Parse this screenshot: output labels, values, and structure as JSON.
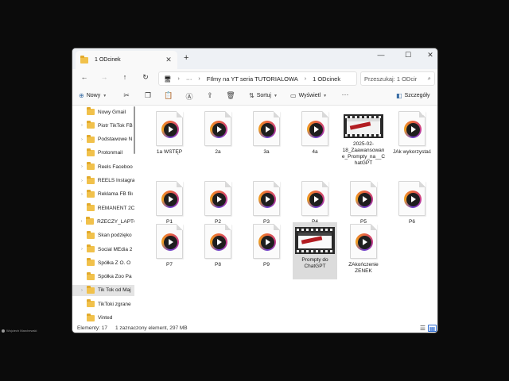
{
  "window": {
    "tab_title": "1 ODcinek",
    "new_tab": "+",
    "controls": {
      "minimize": "—",
      "maximize": "☐",
      "close": "✕"
    }
  },
  "navigation": {
    "back": "←",
    "forward": "→",
    "up": "↑",
    "refresh": "↻",
    "more": "···",
    "breadcrumb": [
      "FIlmy na YT seria TUTORIALOWA",
      "1 ODcinek"
    ],
    "search_placeholder": "Przeszukaj: 1 ODcir"
  },
  "toolbar": {
    "new_label": "Nowy",
    "sort_label": "Sortuj",
    "view_label": "Wyświetl",
    "more": "···",
    "details_label": "Szczegóły"
  },
  "sidebar": {
    "items": [
      {
        "label": "Nowy Gmail",
        "expandable": false
      },
      {
        "label": "Piotr TikTok FB",
        "expandable": true
      },
      {
        "label": "Podstawowe N",
        "expandable": true
      },
      {
        "label": "Protonmail",
        "expandable": false
      },
      {
        "label": "Reels Faceboo",
        "expandable": true
      },
      {
        "label": "REELS Instagra",
        "expandable": true
      },
      {
        "label": "Reklama FB filı",
        "expandable": true
      },
      {
        "label": "REMANENT 2C",
        "expandable": false
      },
      {
        "label": "RZECZY_LAPTC",
        "expandable": true
      },
      {
        "label": "Skan podzięko",
        "expandable": false
      },
      {
        "label": "Social MEdia 2",
        "expandable": true
      },
      {
        "label": "Spółka Z O. O",
        "expandable": false
      },
      {
        "label": "Spółka Zoo Pa",
        "expandable": false
      },
      {
        "label": "Tik Tok od Maj",
        "expandable": true,
        "selected": true
      },
      {
        "label": "TikToki zgrane",
        "expandable": false
      },
      {
        "label": "Vinted",
        "expandable": false
      }
    ]
  },
  "files": [
    {
      "name": "1a WSTĘP",
      "thumb": "play"
    },
    {
      "name": "2a",
      "thumb": "play"
    },
    {
      "name": "3a",
      "thumb": "play"
    },
    {
      "name": "4a",
      "thumb": "play"
    },
    {
      "name": "2025-02-18_Zaawansowane_Prompty_na__ChatGPT",
      "thumb": "film"
    },
    {
      "name": "JAk wykorzystać",
      "thumb": "play"
    },
    {
      "name": "P1",
      "thumb": "play"
    },
    {
      "name": "P2",
      "thumb": "play"
    },
    {
      "name": "P3",
      "thumb": "play"
    },
    {
      "name": "P4",
      "thumb": "play"
    },
    {
      "name": "P5",
      "thumb": "play"
    },
    {
      "name": "P6",
      "thumb": "play"
    },
    {
      "name": "P7",
      "thumb": "play"
    },
    {
      "name": "P8",
      "thumb": "play"
    },
    {
      "name": "P9",
      "thumb": "play"
    },
    {
      "name": "Prompty do ChatGPT",
      "thumb": "film-light",
      "selected": true
    },
    {
      "name": "ZAkończenie ZENEK",
      "thumb": "play"
    }
  ],
  "status": {
    "count": "Elementy: 17",
    "selection": "1 zaznaczony element, 297 MB"
  },
  "overlay": {
    "user_name": "Wojciech Marchewski"
  },
  "colors": {
    "accent": "#2d6bd1",
    "folder": "#f1c14b",
    "selection": "#dcdcdc"
  }
}
